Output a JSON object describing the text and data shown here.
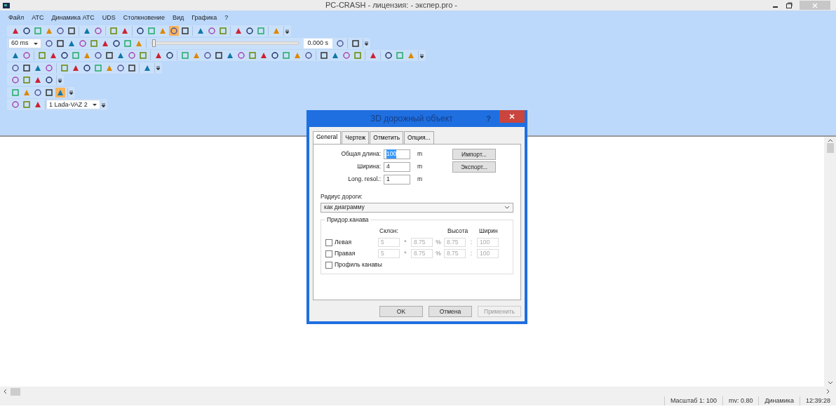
{
  "window": {
    "title": "PC-CRASH - лицензия:  - экспер.pro -"
  },
  "menu": [
    "Файл",
    "АТС",
    "Динамика АТС",
    "UDS",
    "Столкновение",
    "Вид",
    "Графика",
    "?"
  ],
  "toolbars": [
    {
      "items": [
        {
          "kind": "icons",
          "icons": [
            false,
            false,
            false,
            false,
            false,
            false
          ]
        },
        {
          "kind": "icons",
          "icons": [
            false,
            false
          ]
        },
        {
          "kind": "icons",
          "icons": [
            false,
            false
          ]
        },
        {
          "kind": "icons",
          "icons": [
            false,
            false,
            false,
            true,
            false
          ]
        },
        {
          "kind": "icons",
          "icons": [
            false,
            false,
            false
          ]
        },
        {
          "kind": "icons",
          "icons": [
            false,
            false,
            false
          ]
        },
        {
          "kind": "icons",
          "icons": [
            false
          ]
        }
      ]
    },
    {
      "items": [
        {
          "kind": "select",
          "value": "60 ms"
        },
        {
          "kind": "icons",
          "icons": [
            false,
            false,
            false,
            false,
            false,
            false,
            false,
            false,
            false
          ]
        },
        {
          "kind": "slider",
          "level": 0
        },
        {
          "kind": "text",
          "value": "0.000 s"
        },
        {
          "kind": "icons",
          "icons": [
            false
          ]
        },
        {
          "kind": "icons",
          "icons": [
            false
          ]
        }
      ]
    },
    {
      "items": [
        {
          "kind": "icons",
          "icons": [
            false,
            false
          ]
        },
        {
          "kind": "icons",
          "icons": [
            false,
            false,
            false,
            false,
            false,
            false,
            false,
            false,
            false,
            false
          ]
        },
        {
          "kind": "icons",
          "icons": [
            false,
            false
          ]
        },
        {
          "kind": "icons",
          "icons": [
            false,
            false,
            false,
            false,
            false,
            false,
            false,
            false,
            false,
            false,
            false,
            false
          ]
        },
        {
          "kind": "icons",
          "icons": [
            false,
            false,
            false,
            false
          ]
        },
        {
          "kind": "icons",
          "icons": [
            false
          ]
        },
        {
          "kind": "icons",
          "icons": [
            false,
            false,
            false
          ]
        }
      ]
    },
    {
      "items": [
        {
          "kind": "icons",
          "icons": [
            false,
            false,
            false,
            false
          ]
        },
        {
          "kind": "icons",
          "icons": [
            false,
            false,
            false,
            false,
            false,
            false,
            false
          ]
        },
        {
          "kind": "icons",
          "icons": [
            false
          ]
        }
      ]
    },
    {
      "items": [
        {
          "kind": "icons",
          "icons": [
            false,
            false,
            false,
            false
          ]
        }
      ]
    },
    {
      "items": [
        {
          "kind": "icons",
          "icons": [
            false,
            false,
            false,
            false,
            true
          ]
        }
      ]
    },
    {
      "items": [
        {
          "kind": "icons",
          "icons": [
            false,
            false,
            false
          ]
        },
        {
          "kind": "select",
          "value": "1 Lada-VAZ 2"
        }
      ]
    }
  ],
  "dialog": {
    "title": "3D дорожный объект",
    "help": "?",
    "tabs": [
      {
        "label": "General",
        "selected": true
      },
      {
        "label": "Чертеж",
        "selected": false
      },
      {
        "label": "Отметить",
        "selected": false
      },
      {
        "label": "Опция...",
        "selected": false
      }
    ],
    "fields": [
      {
        "label": "Общая длина:",
        "value": "100",
        "unit": "m",
        "selected": true
      },
      {
        "label": "Ширина:",
        "value": "4",
        "unit": "m",
        "selected": false
      },
      {
        "label": "Long. resol.:",
        "value": "1",
        "unit": "m",
        "selected": false
      }
    ],
    "side_buttons": [
      "Импорт...",
      "Экспорт..."
    ],
    "radius_label": "Радиус дороги:",
    "radius_value": "как диаграмму",
    "ditch": {
      "title": "Придор.канава",
      "columns": [
        "Склон:",
        "Высота",
        "Ширин"
      ],
      "rows": [
        {
          "label": "Левая",
          "checked": false,
          "values": [
            "5",
            "*",
            "8.75",
            "%",
            "8.75",
            ":",
            "100"
          ]
        },
        {
          "label": "Правая",
          "checked": false,
          "values": [
            "5",
            "*",
            "8.75",
            "%",
            "8.75",
            ":",
            "100"
          ]
        }
      ],
      "profile": {
        "label": "Профиль канавы",
        "checked": false
      }
    },
    "buttons": [
      {
        "label": "OK",
        "disabled": false
      },
      {
        "label": "Отмена",
        "disabled": false
      },
      {
        "label": "Применить",
        "disabled": true
      }
    ]
  },
  "status_bar": [
    "Масштаб 1: 100",
    "mv: 0.80",
    "Динамика",
    "12:39:28"
  ]
}
